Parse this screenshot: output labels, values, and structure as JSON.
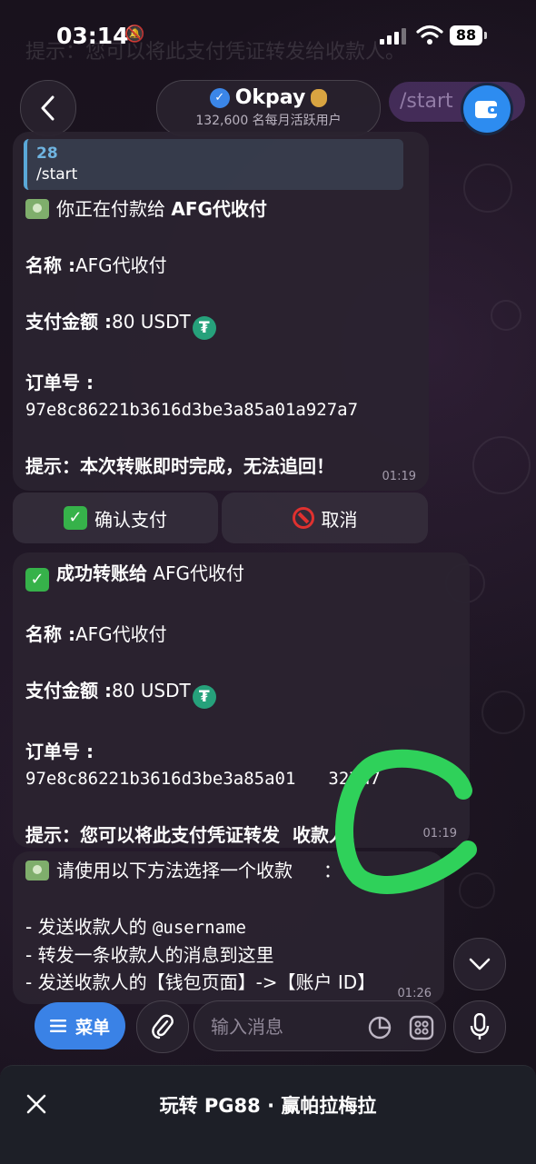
{
  "status_bar": {
    "time": "03:14",
    "battery": "88"
  },
  "preview_text": "提示：您可以将此支付凭证转发给收款人。",
  "header": {
    "title": "Okpay",
    "subtitle": "132,600 名每月活跃用户",
    "start_chip": "/start",
    "verified_color": "#3b86e8"
  },
  "msg1": {
    "reply_id": "28",
    "reply_text": "/start",
    "line1_prefix": "你正在付款给 ",
    "line1_bold": "AFG代收付",
    "name_label": "名称 :",
    "name_value": "AFG代收付",
    "amount_label": "支付金额 :",
    "amount_value": "80 USDT",
    "order_label": "订单号 :",
    "order_value": "97e8c86221b3616d3be3a85a01a927a7",
    "tip": "提示：本次转账即时完成，无法追回！",
    "time": "01:19"
  },
  "buttons": {
    "confirm": "确认支付",
    "cancel": "取消"
  },
  "msg2": {
    "line1_bold": "成功转账给",
    "line1_rest": " AFG代收付",
    "name_label": "名称 :",
    "name_value": "AFG代收付",
    "amount_label": "支付金额 :",
    "amount_value": "80 USDT",
    "order_label": "订单号 :",
    "order_value": "97e8c86221b3616d3be3a85a01",
    "order_value_tail": "327a7",
    "tip": "提示：您可以将此支付凭证转发",
    "tip_tail": "收款人。",
    "time": "01:19"
  },
  "msg3": {
    "line1": "请使用以下方法选择一个收款",
    "line1_tail": "：",
    "item1_prefix": "- 发送收款人的 ",
    "item1_mono": "@username",
    "item2": "- 转发一条收款人的消息到这里",
    "item3": "- 发送收款人的【钱包页面】->【账户 ID】",
    "time": "01:26"
  },
  "input_bar": {
    "menu_label": "菜单",
    "placeholder": "输入消息"
  },
  "bottom_bar": {
    "title": "玩转 PG88 · 赢帕拉梅拉"
  },
  "colors": {
    "accent": "#3a82e6",
    "tether": "#26a17b",
    "annotation": "#2fd15a"
  }
}
